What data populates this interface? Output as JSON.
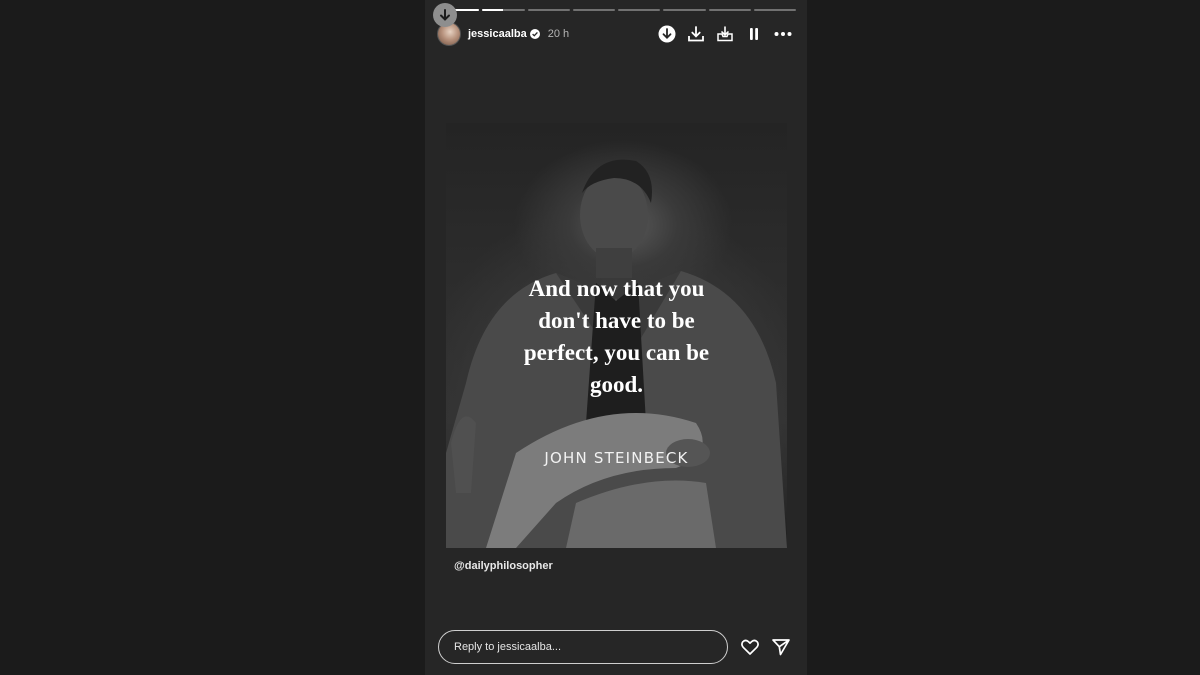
{
  "story": {
    "progress": [
      1,
      0.5,
      0,
      0,
      0,
      0,
      0,
      0
    ],
    "user": {
      "username": "jessicaalba",
      "verified": true,
      "time": "20 h"
    },
    "header_icons": [
      "download-circle-icon",
      "download-icon",
      "save-to-tray-icon",
      "pause-icon",
      "more-icon"
    ],
    "post": {
      "quote": "And now that you don't have to be perfect, you can be good.",
      "author": "JOHN STEINBECK",
      "credit": "@dailyphilosopher"
    },
    "footer": {
      "reply_placeholder": "Reply to jessicaalba...",
      "icons": [
        "heart-icon",
        "send-icon"
      ]
    }
  }
}
